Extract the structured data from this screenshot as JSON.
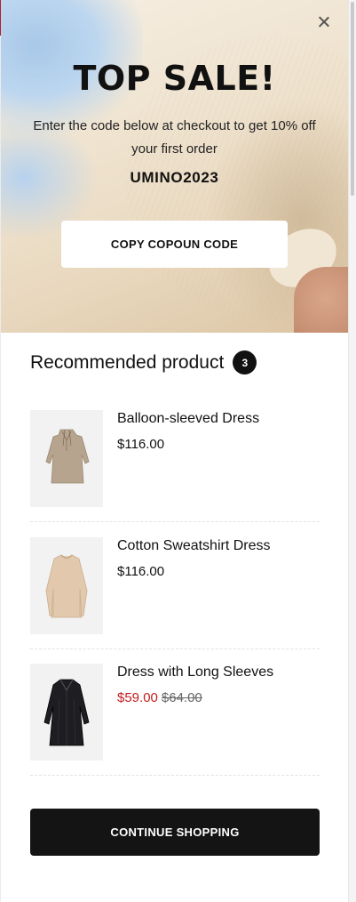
{
  "popup": {
    "close_icon": "close-icon",
    "title": "TOP SALE!",
    "description": "Enter the code below at checkout to get 10% off your first order",
    "coupon_code": "UMINO2023",
    "copy_button_label": "COPY COPOUN CODE"
  },
  "recommended": {
    "title": "Recommended product",
    "count": "3",
    "products": [
      {
        "name": "Balloon-sleeved Dress",
        "price": "$116.00",
        "sale_price": "",
        "old_price": "",
        "image_icon": "beige-dress-image"
      },
      {
        "name": "Cotton Sweatshirt Dress",
        "price": "$116.00",
        "sale_price": "",
        "old_price": "",
        "image_icon": "sweatshirt-dress-image"
      },
      {
        "name": "Dress with Long Sleeves",
        "price": "",
        "sale_price": "$59.00",
        "old_price": "$64.00",
        "image_icon": "black-dress-image"
      }
    ]
  },
  "footer": {
    "continue_label": "CONTINUE SHOPPING"
  },
  "colors": {
    "accent": "#141414",
    "sale_red": "#c41e1e",
    "badge": "#111111"
  }
}
